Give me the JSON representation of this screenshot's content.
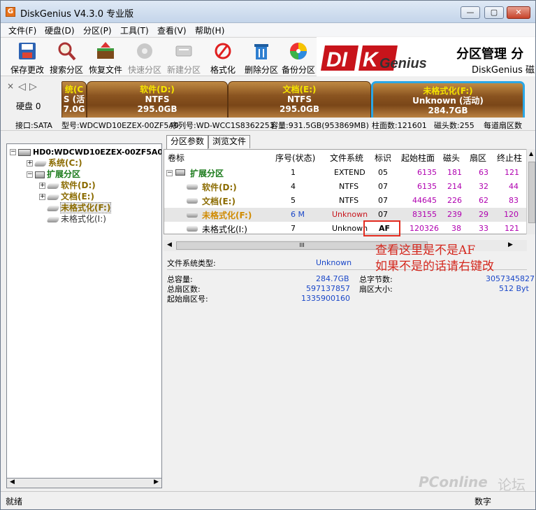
{
  "window": {
    "title": "DiskGenius V4.3.0 专业版",
    "minimize": "—",
    "maximize": "▢",
    "close": "✕"
  },
  "menu": [
    "文件(F)",
    "硬盘(D)",
    "分区(P)",
    "工具(T)",
    "查看(V)",
    "帮助(H)"
  ],
  "toolbar": [
    {
      "label": "保存更改",
      "icon": "save-icon",
      "enabled": true
    },
    {
      "label": "搜索分区",
      "icon": "search-icon",
      "enabled": true
    },
    {
      "label": "恢复文件",
      "icon": "recover-icon",
      "enabled": true
    },
    {
      "label": "快速分区",
      "icon": "quick-partition-icon",
      "enabled": false
    },
    {
      "label": "新建分区",
      "icon": "new-partition-icon",
      "enabled": false
    },
    {
      "label": "格式化",
      "icon": "format-icon",
      "enabled": true
    },
    {
      "label": "删除分区",
      "icon": "trash-icon",
      "enabled": true
    },
    {
      "label": "备份分区",
      "icon": "backup-icon",
      "enabled": true
    }
  ],
  "brand": {
    "logo_left": "DI",
    "logo_k": "K",
    "logo_right": "Genius",
    "title": "分区管理 分",
    "subtitle": "DiskGenius 磁"
  },
  "diskmap": {
    "label": "硬盘 0",
    "partitions": [
      {
        "name": "统(C",
        "line2": "S (活",
        "size": "7.0G",
        "active": false
      },
      {
        "name": "软件(D:)",
        "line2": "NTFS",
        "size": "295.0GB",
        "active": false
      },
      {
        "name": "文档(E:)",
        "line2": "NTFS",
        "size": "295.0GB",
        "active": false
      },
      {
        "name": "未格式化(F:)",
        "line2": "Unknown (活动)",
        "size": "284.7GB",
        "active": true
      }
    ]
  },
  "info": {
    "interface": "接口:SATA",
    "model": "型号:WDCWD10EZEX-00ZF5A0",
    "serial": "序列号:WD-WCC1S8362253",
    "capacity": "容量:931.5GB(953869MB)",
    "cylinders": "柱面数:121601",
    "heads": "磁头数:255",
    "sectors": "每道扇区数"
  },
  "tree": {
    "disk": "HD0:WDCWD10EZEX-00ZF5A0 (9",
    "items": [
      {
        "label": "系统(C:)",
        "style": "sys"
      },
      {
        "label": "扩展分区",
        "style": "ext"
      },
      {
        "label": "软件(D:)",
        "style": "sub"
      },
      {
        "label": "文档(E:)",
        "style": "sub"
      },
      {
        "label": "未格式化(F:)",
        "style": "subsel"
      },
      {
        "label": "未格式化(I:)",
        "style": "sub"
      }
    ]
  },
  "tabs": {
    "params": "分区参数",
    "browse": "浏览文件"
  },
  "table": {
    "headers": [
      "卷标",
      "序号(状态)",
      "文件系统",
      "标识",
      "起始柱面",
      "磁头",
      "扇区",
      "终止柱"
    ],
    "rows": [
      {
        "name": "扩展分区",
        "seq": "1",
        "fs": "EXTEND",
        "id": "05",
        "cyl": "6135",
        "head": "181",
        "sec": "63",
        "end": "121",
        "kind": "ext"
      },
      {
        "name": "软件(D:)",
        "seq": "4",
        "fs": "NTFS",
        "id": "07",
        "cyl": "6135",
        "head": "214",
        "sec": "32",
        "end": "44",
        "kind": "sub"
      },
      {
        "name": "文档(E:)",
        "seq": "5",
        "fs": "NTFS",
        "id": "07",
        "cyl": "44645",
        "head": "226",
        "sec": "62",
        "end": "83",
        "kind": "sub"
      },
      {
        "name": "未格式化(F:)",
        "seq": "6 M",
        "fs": "Unknown",
        "id": "07",
        "cyl": "83155",
        "head": "239",
        "sec": "29",
        "end": "120",
        "kind": "sel"
      },
      {
        "name": "未格式化(I:)",
        "seq": "7",
        "fs": "Unknown",
        "id": "AF",
        "cyl": "120326",
        "head": "38",
        "sec": "33",
        "end": "121",
        "kind": "plain"
      }
    ],
    "hscroll_grip": "III"
  },
  "annotation": {
    "line1": "查看这里是不是AF",
    "line2": "如果不是的话请右键改"
  },
  "details": {
    "fs_type_label": "文件系统类型:",
    "fs_type_value": "Unknown",
    "total_cap_label": "总容量:",
    "total_cap_value": "284.7GB",
    "total_bytes_label": "总字节数:",
    "total_bytes_value": "3057345827",
    "total_sectors_label": "总扇区数:",
    "total_sectors_value": "597137857",
    "sector_size_label": "扇区大小:",
    "sector_size_value": "512 Byt",
    "start_sector_label": "起始扇区号:",
    "start_sector_value": "1335900160"
  },
  "status": {
    "left": "就绪",
    "right": "数字"
  },
  "watermark": {
    "text": "PConline",
    "text2": "论坛"
  }
}
